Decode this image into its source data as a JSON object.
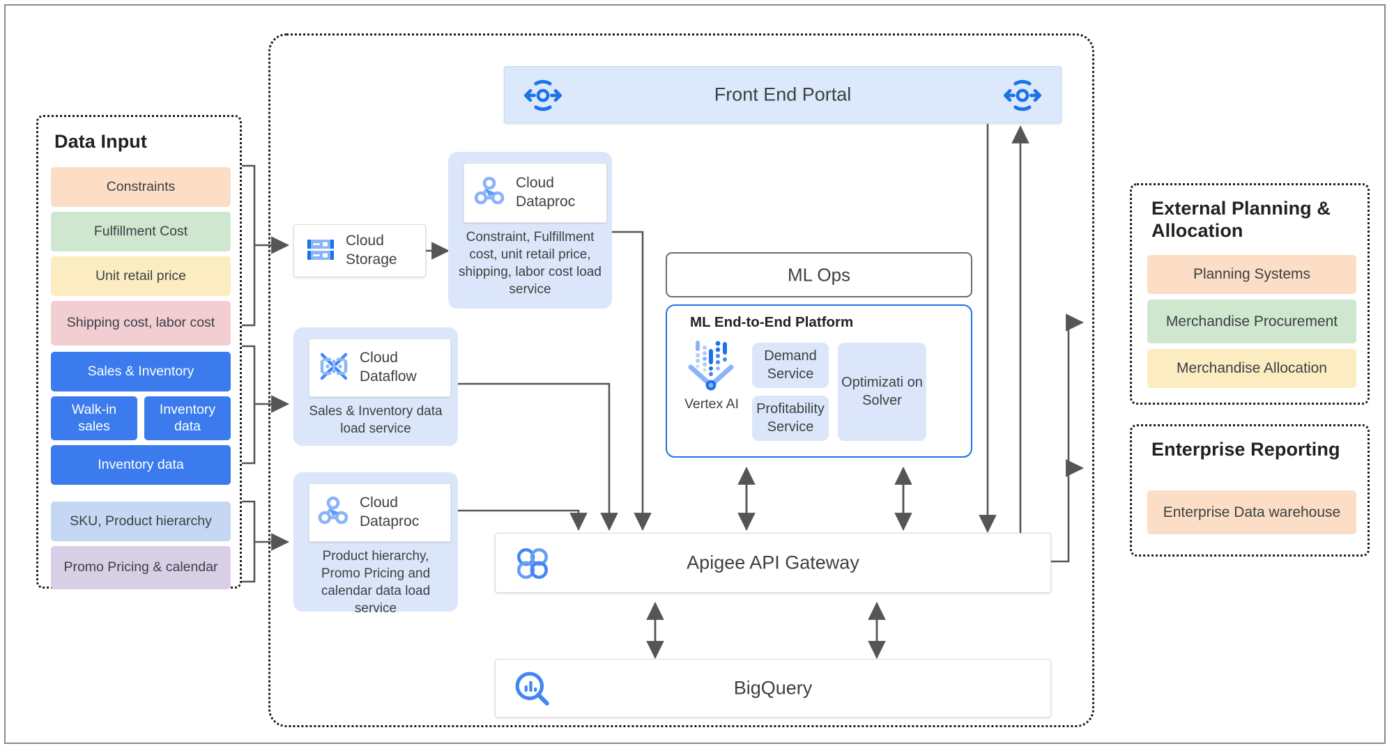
{
  "data_input": {
    "title": "Data Input",
    "chips": [
      {
        "label": "Constraints",
        "color": "#fbdec5"
      },
      {
        "label": "Fulfillment Cost",
        "color": "#cfe6cf"
      },
      {
        "label": "Unit retail price",
        "color": "#fcecc2"
      },
      {
        "label": "Shipping cost, labor cost",
        "color": "#f2ced3"
      },
      {
        "label": "Sales & Inventory",
        "color": "#3b7bed"
      },
      {
        "label": "Walk-in sales",
        "color": "#3b7bed"
      },
      {
        "label": "Inventory data",
        "color": "#3b7bed"
      },
      {
        "label": "Inventory data",
        "color": "#3b7bed"
      },
      {
        "label": "SKU, Product hierarchy",
        "color": "#c5d7f2"
      },
      {
        "label": "Promo Pricing & calendar",
        "color": "#d8cfe7"
      }
    ]
  },
  "front_end_portal": {
    "label": "Front End Portal",
    "left_icon": "load-balancer-icon",
    "right_icon": "load-balancer-icon"
  },
  "pipelines": [
    {
      "id": "cloud-storage",
      "product": "Cloud Storage",
      "icon": "cloud-storage-icon",
      "description": ""
    },
    {
      "id": "dataproc-constraints",
      "product": "Cloud Dataproc",
      "icon": "cloud-dataproc-icon",
      "description": "Constraint, Fulfillment cost, unit retail price, shipping, labor cost load service"
    },
    {
      "id": "dataflow-sales",
      "product": "Cloud Dataflow",
      "icon": "cloud-dataflow-icon",
      "description": "Sales & Inventory data load service"
    },
    {
      "id": "dataproc-product",
      "product": "Cloud Dataproc",
      "icon": "cloud-dataproc-icon",
      "description": "Product hierarchy, Promo Pricing and calendar data load service"
    }
  ],
  "mlops": {
    "title": "ML Ops"
  },
  "ml_platform": {
    "title": "ML End-to-End Platform",
    "vertex": {
      "label": "Vertex AI",
      "icon": "vertex-ai-icon"
    },
    "services": [
      {
        "label": "Demand Service"
      },
      {
        "label": "Profitability Service"
      },
      {
        "label": "Optimizati on Solver"
      }
    ]
  },
  "apigee": {
    "label": "Apigee API Gateway",
    "icon": "apigee-icon"
  },
  "bigquery": {
    "label": "BigQuery",
    "icon": "bigquery-icon"
  },
  "external_planning": {
    "title": "External Planning & Allocation",
    "chips": [
      {
        "label": "Planning Systems",
        "color": "#fbdec5"
      },
      {
        "label": "Merchandise Procurement",
        "color": "#cfe6cf"
      },
      {
        "label": "Merchandise Allocation",
        "color": "#fcecc2"
      }
    ]
  },
  "enterprise_reporting": {
    "title": "Enterprise Reporting",
    "chips": [
      {
        "label": "Enterprise Data warehouse",
        "color": "#fbdec5"
      }
    ]
  },
  "colors": {
    "accent_blue": "#1a73e8",
    "panel_blue": "#dbe6fa",
    "arrow": "#555555",
    "chip_blue": "#3b7bed"
  }
}
